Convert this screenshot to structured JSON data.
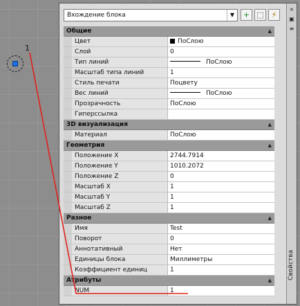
{
  "canvas": {
    "attribute_text": "1"
  },
  "palette": {
    "selector": "Вхождение блока",
    "side_title": "Свойства",
    "side_buttons": [
      "×",
      "▣",
      "≡"
    ]
  },
  "sections": [
    {
      "title": "Общие",
      "rows": [
        {
          "name": "Цвет",
          "value": "ПоСлою",
          "kind": "color"
        },
        {
          "name": "Слой",
          "value": "0"
        },
        {
          "name": "Тип линий",
          "value": "ПоСлою",
          "kind": "line"
        },
        {
          "name": "Масштаб типа линий",
          "value": "1"
        },
        {
          "name": "Стиль печати",
          "value": "Поцвету"
        },
        {
          "name": "Вес линий",
          "value": "ПоСлою",
          "kind": "line"
        },
        {
          "name": "Прозрачность",
          "value": "ПоСлою"
        },
        {
          "name": "Гиперссылка",
          "value": ""
        }
      ]
    },
    {
      "title": "3D визуализация",
      "rows": [
        {
          "name": "Материал",
          "value": "ПоСлою"
        }
      ]
    },
    {
      "title": "Геометрия",
      "rows": [
        {
          "name": "Положение X",
          "value": "2744.7914"
        },
        {
          "name": "Положение Y",
          "value": "1010.2072"
        },
        {
          "name": "Положение Z",
          "value": "0"
        },
        {
          "name": "Масштаб X",
          "value": "1"
        },
        {
          "name": "Масштаб Y",
          "value": "1"
        },
        {
          "name": "Масштаб Z",
          "value": "1"
        }
      ]
    },
    {
      "title": "Разное",
      "rows": [
        {
          "name": "Имя",
          "value": "Test"
        },
        {
          "name": "Поворот",
          "value": "0"
        },
        {
          "name": "Аннотативный",
          "value": "Нет"
        },
        {
          "name": "Единицы блока",
          "value": "Миллиметры"
        },
        {
          "name": "Коэффициент единиц",
          "value": "1"
        }
      ]
    },
    {
      "title": "Атрибуты",
      "rows": [
        {
          "name": "NUM",
          "value": "1"
        }
      ]
    }
  ],
  "colors": {
    "annotation_line": "#e0201b",
    "grip": "#1e6fe0"
  }
}
